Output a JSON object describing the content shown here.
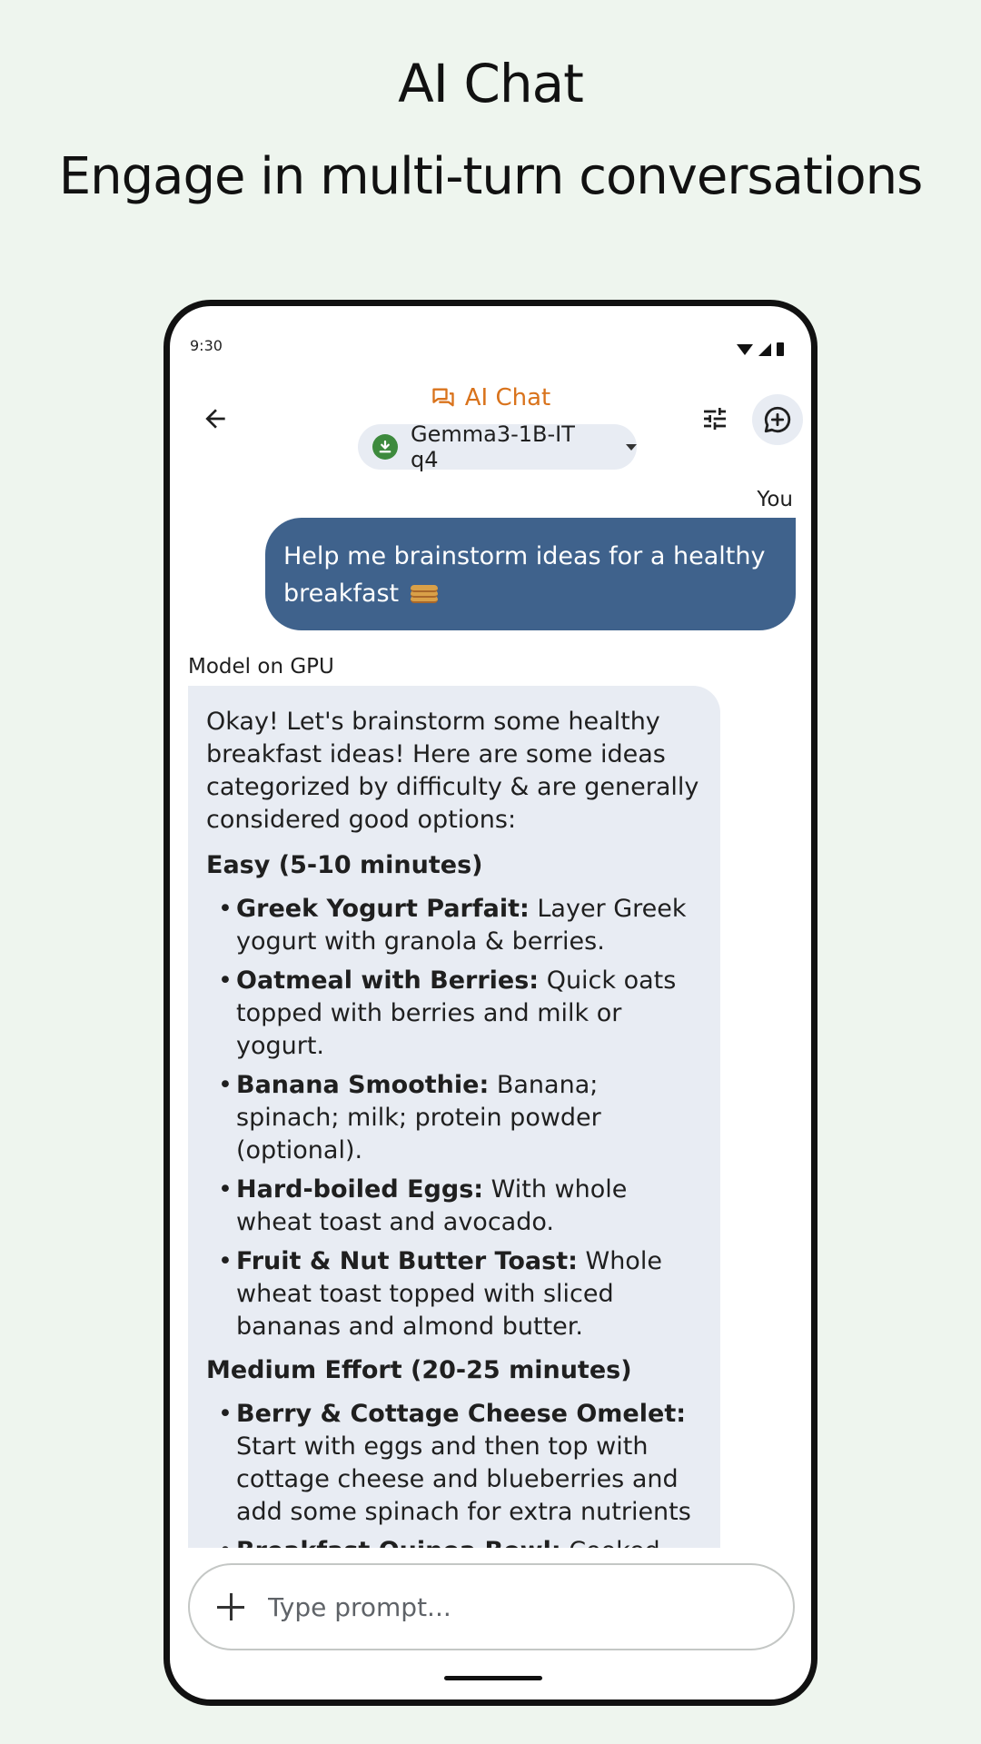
{
  "hero": {
    "title": "AI Chat",
    "subtitle": "Engage in multi-turn conversations"
  },
  "status_bar": {
    "time": "9:30"
  },
  "header": {
    "title": "AI Chat",
    "model_name": "Gemma3-1B-IT q4",
    "accent_color": "#d9731c"
  },
  "chat": {
    "user_label": "You",
    "user_message": "Help me brainstorm ideas for a healthy breakfast",
    "user_emoji": "pancakes",
    "model_label": "Model on GPU",
    "model_intro": "Okay! Let's brainstorm some healthy breakfast ideas! Here are some ideas categorized by difficulty & are generally considered good options:",
    "sections": [
      {
        "heading": "Easy (5-10 minutes)",
        "items": [
          {
            "name": "Greek Yogurt Parfait:",
            "desc": "Layer Greek yogurt with granola & berries."
          },
          {
            "name": "Oatmeal with Berries:",
            "desc": "Quick oats topped with berries and milk or yogurt."
          },
          {
            "name": "Banana Smoothie:",
            "desc": "Banana; spinach; milk; protein powder (optional)."
          },
          {
            "name": "Hard-boiled Eggs:",
            "desc": "With whole wheat toast and avocado."
          },
          {
            "name": "Fruit & Nut Butter Toast:",
            "desc": "Whole wheat toast topped with sliced bananas and almond butter."
          }
        ]
      },
      {
        "heading": "Medium Effort (20-25 minutes)",
        "items": [
          {
            "name": "Berry & Cottage Cheese Omelet:",
            "desc": "Start with eggs and then top with cottage cheese and blueberries and add some spinach for extra nutrients"
          },
          {
            "name": "Breakfast Quinoa Bowl:",
            "desc": "Cooked quinoa topped with yogurt and"
          }
        ]
      }
    ]
  },
  "composer": {
    "placeholder": "Type prompt..."
  },
  "icons": {
    "back": "arrow-back-icon",
    "chat": "chat-bubbles-icon",
    "download": "download-done-icon",
    "tune": "tune-icon",
    "new_chat": "add-comment-icon",
    "add": "plus-icon"
  },
  "colors": {
    "background": "#eef5ee",
    "user_bubble": "#3f628c",
    "model_bubble": "#e8ecf3",
    "download_badge": "#3d8a3d"
  }
}
